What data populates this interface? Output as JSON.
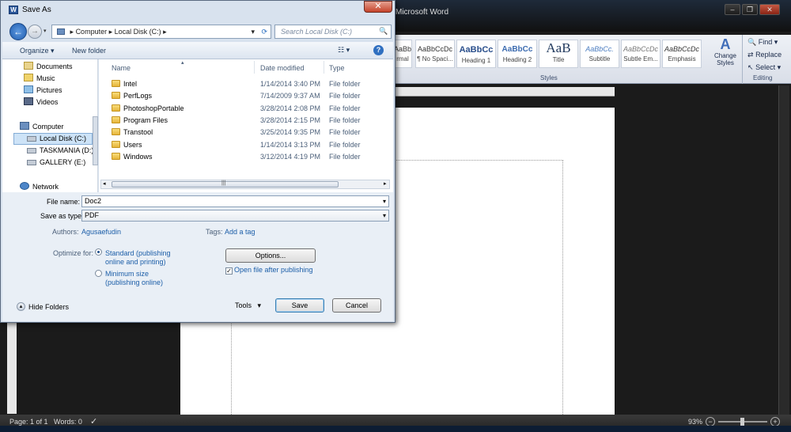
{
  "word": {
    "title": "Microsoft Word",
    "styles": [
      {
        "preview": "AaBbCcDc",
        "name": "rmal"
      },
      {
        "preview": "AaBbCcDc",
        "name": "¶ No Spaci..."
      },
      {
        "preview": "AaBbCc",
        "name": "Heading 1"
      },
      {
        "preview": "AaBbCc",
        "name": "Heading 2"
      },
      {
        "preview": "AaB",
        "name": "Title"
      },
      {
        "preview": "AaBbCc.",
        "name": "Subtitle"
      },
      {
        "preview": "AaBbCcDc",
        "name": "Subtle Em..."
      },
      {
        "preview": "AaBbCcDc",
        "name": "Emphasis"
      }
    ],
    "change_styles": "Change Styles",
    "styles_group": "Styles",
    "editing_group": "Editing",
    "find": "Find",
    "replace": "Replace",
    "select": "Select",
    "status": {
      "page": "Page: 1 of 1",
      "words": "Words: 0",
      "zoom": "93%"
    }
  },
  "dialog": {
    "title": "Save As",
    "address": [
      "Computer",
      "Local Disk (C:)"
    ],
    "search_placeholder": "Search Local Disk (C:)",
    "organize": "Organize",
    "new_folder": "New folder",
    "nav": {
      "documents": "Documents",
      "music": "Music",
      "pictures": "Pictures",
      "videos": "Videos",
      "computer": "Computer",
      "local_disk": "Local Disk (C:)",
      "taskmania": "TASKMANIA (D:)",
      "gallery": "GALLERY (E:)",
      "network": "Network"
    },
    "columns": {
      "name": "Name",
      "date": "Date modified",
      "type": "Type"
    },
    "files": [
      {
        "name": "Intel",
        "date": "1/14/2014 3:40 PM",
        "type": "File folder"
      },
      {
        "name": "PerfLogs",
        "date": "7/14/2009 9:37 AM",
        "type": "File folder"
      },
      {
        "name": "PhotoshopPortable",
        "date": "3/28/2014 2:08 PM",
        "type": "File folder"
      },
      {
        "name": "Program Files",
        "date": "3/28/2014 2:15 PM",
        "type": "File folder"
      },
      {
        "name": "Transtool",
        "date": "3/25/2014 9:35 PM",
        "type": "File folder"
      },
      {
        "name": "Users",
        "date": "1/14/2014 3:13 PM",
        "type": "File folder"
      },
      {
        "name": "Windows",
        "date": "3/12/2014 4:19 PM",
        "type": "File folder"
      }
    ],
    "file_name_label": "File name:",
    "file_name_value": "Doc2",
    "save_type_label": "Save as type:",
    "save_type_value": "PDF",
    "authors_label": "Authors:",
    "authors_value": "Agusaefudin",
    "tags_label": "Tags:",
    "tags_value": "Add a tag",
    "optimize_label": "Optimize for:",
    "opt_standard_1": "Standard (publishing",
    "opt_standard_2": "online and printing)",
    "opt_min_1": "Minimum size",
    "opt_min_2": "(publishing online)",
    "options_btn": "Options...",
    "open_after": "Open file after publishing",
    "hide_folders": "Hide Folders",
    "tools": "Tools",
    "save": "Save",
    "cancel": "Cancel"
  }
}
